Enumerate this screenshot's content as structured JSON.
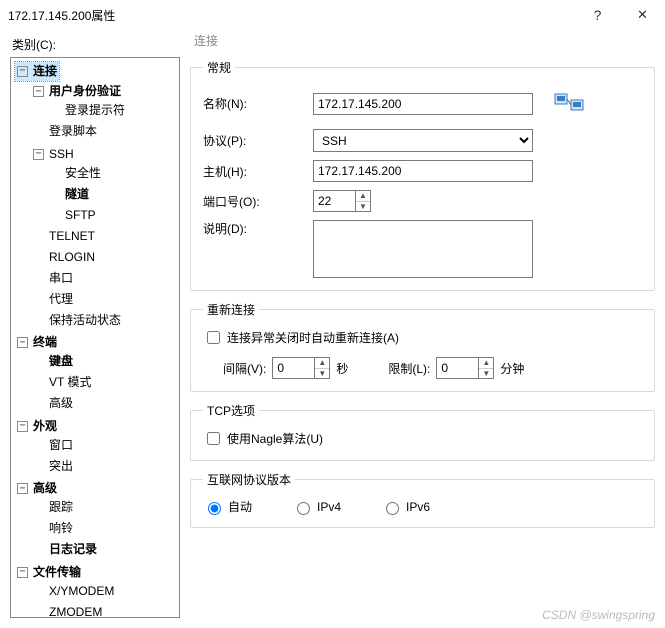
{
  "title": "172.17.145.200属性",
  "category_label": "类别(C):",
  "tree": {
    "connection": "连接",
    "user_auth": "用户身份验证",
    "login_prompt": "登录提示符",
    "login_script": "登录脚本",
    "ssh": "SSH",
    "security": "安全性",
    "tunnel": "隧道",
    "sftp": "SFTP",
    "telnet": "TELNET",
    "rlogin": "RLOGIN",
    "serial": "串口",
    "proxy": "代理",
    "keepalive": "保持活动状态",
    "terminal": "终端",
    "keyboard": "键盘",
    "vtmode": "VT 模式",
    "advanced1": "高级",
    "appearance": "外观",
    "window": "窗口",
    "highlight": "突出",
    "advanced2": "高级",
    "trace": "跟踪",
    "bell": "响铃",
    "logging": "日志记录",
    "filetransfer": "文件传输",
    "xymodem": "X/YMODEM",
    "zmodem": "ZMODEM"
  },
  "panel_title": "连接",
  "groups": {
    "general": "常规",
    "reconnect": "重新连接",
    "tcp": "TCP选项",
    "ipver": "互联网协议版本"
  },
  "general": {
    "name_label": "名称(N):",
    "name_value": "172.17.145.200",
    "protocol_label": "协议(P):",
    "protocol_value": "SSH",
    "host_label": "主机(H):",
    "host_value": "172.17.145.200",
    "port_label": "端口号(O):",
    "port_value": "22",
    "desc_label": "说明(D):"
  },
  "reconnect": {
    "checkbox": "连接异常关闭时自动重新连接(A)",
    "interval_label": "间隔(V):",
    "interval_value": "0",
    "sec": "秒",
    "limit_label": "限制(L):",
    "limit_value": "0",
    "min": "分钟"
  },
  "tcp": {
    "nagle": "使用Nagle算法(U)"
  },
  "ipver": {
    "auto": "自动",
    "ipv4": "IPv4",
    "ipv6": "IPv6"
  },
  "watermark": "CSDN @swingspring"
}
